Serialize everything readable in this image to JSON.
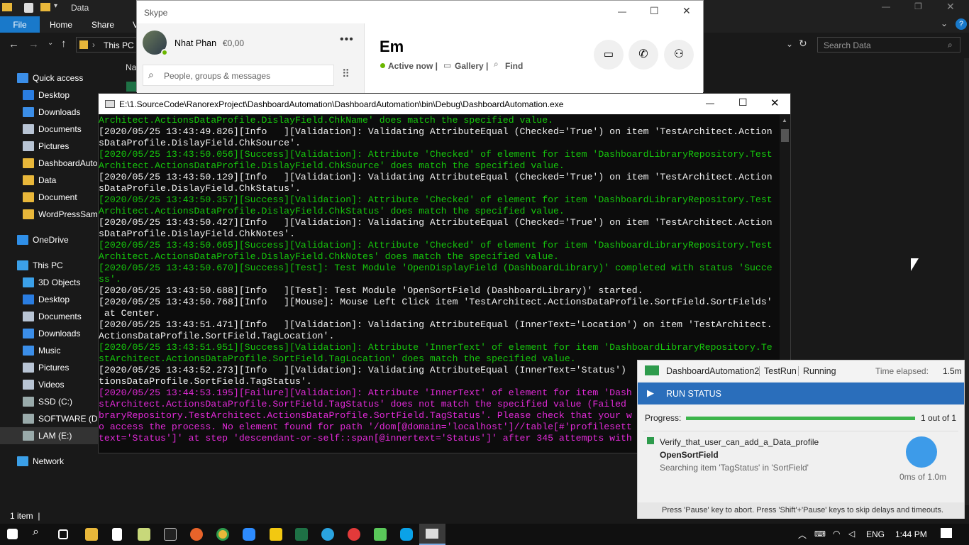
{
  "explorer": {
    "title": "Data",
    "ribbon_tabs": [
      "File",
      "Home",
      "Share",
      "V"
    ],
    "address_path": "This PC",
    "search_placeholder": "Search Data",
    "column_header": "Na",
    "nav_items": [
      {
        "label": "Quick access",
        "icon": "star-icon",
        "color": "#3b8ee8",
        "indent": 0
      },
      {
        "label": "Desktop",
        "icon": "desktop-icon",
        "color": "#2a7de1",
        "indent": 1
      },
      {
        "label": "Downloads",
        "icon": "download-icon",
        "color": "#3b8ee8",
        "indent": 1
      },
      {
        "label": "Documents",
        "icon": "documents-icon",
        "color": "#b8c4d4",
        "indent": 1
      },
      {
        "label": "Pictures",
        "icon": "pictures-icon",
        "color": "#b8c4d4",
        "indent": 1
      },
      {
        "label": "DashboardAuto",
        "icon": "folder-icon",
        "color": "#e8b73a",
        "indent": 1
      },
      {
        "label": "Data",
        "icon": "folder-icon",
        "color": "#e8b73a",
        "indent": 1
      },
      {
        "label": "Document",
        "icon": "folder-icon",
        "color": "#e8b73a",
        "indent": 1
      },
      {
        "label": "WordPressSamp",
        "icon": "folder-icon",
        "color": "#e8b73a",
        "indent": 1
      },
      {
        "label": "",
        "icon": "",
        "color": "",
        "indent": 0
      },
      {
        "label": "OneDrive",
        "icon": "cloud-icon",
        "color": "#2f8fe8",
        "indent": 0
      },
      {
        "label": "",
        "icon": "",
        "color": "",
        "indent": 0
      },
      {
        "label": "This PC",
        "icon": "computer-icon",
        "color": "#3ba0e8",
        "indent": 0
      },
      {
        "label": "3D Objects",
        "icon": "cube-icon",
        "color": "#3ba0e8",
        "indent": 1
      },
      {
        "label": "Desktop",
        "icon": "desktop-icon",
        "color": "#2a7de1",
        "indent": 1
      },
      {
        "label": "Documents",
        "icon": "documents-icon",
        "color": "#b8c4d4",
        "indent": 1
      },
      {
        "label": "Downloads",
        "icon": "download-icon",
        "color": "#3b8ee8",
        "indent": 1
      },
      {
        "label": "Music",
        "icon": "music-icon",
        "color": "#3b8ee8",
        "indent": 1
      },
      {
        "label": "Pictures",
        "icon": "pictures-icon",
        "color": "#b8c4d4",
        "indent": 1
      },
      {
        "label": "Videos",
        "icon": "video-icon",
        "color": "#b8c4d4",
        "indent": 1
      },
      {
        "label": "SSD (C:)",
        "icon": "drive-icon",
        "color": "#9aa",
        "indent": 1
      },
      {
        "label": "SOFTWARE (D:)",
        "icon": "drive-icon",
        "color": "#9aa",
        "indent": 1
      },
      {
        "label": "LAM (E:)",
        "icon": "drive-icon",
        "color": "#9aa",
        "indent": 1
      },
      {
        "label": "",
        "icon": "",
        "color": "",
        "indent": 0
      },
      {
        "label": "Network",
        "icon": "network-icon",
        "color": "#3ba0e8",
        "indent": 0
      }
    ],
    "status": "1 item  |"
  },
  "skype": {
    "title": "Skype",
    "user_name": "Nhat  Phan",
    "balance": "€0,00",
    "search_placeholder": "People, groups & messages",
    "contact_name": "Em",
    "presence": "Active now |",
    "gallery": "Gallery |",
    "find": "Find"
  },
  "console": {
    "title": "E:\\1.SourceCode\\RanorexProject\\DashboardAutomation\\DashboardAutomation\\bin\\Debug\\DashboardAutomation.exe",
    "lines": [
      {
        "t": "Architect.ActionsDataProfile.DislayField.ChkName' does match the specified value.",
        "c": "#16c60c"
      },
      {
        "t": "[2020/05/25 13:43:49.826][Info   ][Validation]: Validating AttributeEqual (Checked='True') on item 'TestArchitect.Action",
        "c": "#f2f2f2"
      },
      {
        "t": "sDataProfile.DislayField.ChkSource'.",
        "c": "#f2f2f2"
      },
      {
        "t": "[2020/05/25 13:43:50.056][Success][Validation]: Attribute 'Checked' of element for item 'DashboardLibraryRepository.Test",
        "c": "#16c60c"
      },
      {
        "t": "Architect.ActionsDataProfile.DislayField.ChkSource' does match the specified value.",
        "c": "#16c60c"
      },
      {
        "t": "[2020/05/25 13:43:50.129][Info   ][Validation]: Validating AttributeEqual (Checked='True') on item 'TestArchitect.Action",
        "c": "#f2f2f2"
      },
      {
        "t": "sDataProfile.DislayField.ChkStatus'.",
        "c": "#f2f2f2"
      },
      {
        "t": "[2020/05/25 13:43:50.357][Success][Validation]: Attribute 'Checked' of element for item 'DashboardLibraryRepository.Test",
        "c": "#16c60c"
      },
      {
        "t": "Architect.ActionsDataProfile.DislayField.ChkStatus' does match the specified value.",
        "c": "#16c60c"
      },
      {
        "t": "[2020/05/25 13:43:50.427][Info   ][Validation]: Validating AttributeEqual (Checked='True') on item 'TestArchitect.Action",
        "c": "#f2f2f2"
      },
      {
        "t": "sDataProfile.DislayField.ChkNotes'.",
        "c": "#f2f2f2"
      },
      {
        "t": "[2020/05/25 13:43:50.665][Success][Validation]: Attribute 'Checked' of element for item 'DashboardLibraryRepository.Test",
        "c": "#16c60c"
      },
      {
        "t": "Architect.ActionsDataProfile.DislayField.ChkNotes' does match the specified value.",
        "c": "#16c60c"
      },
      {
        "t": "[2020/05/25 13:43:50.670][Success][Test]: Test Module 'OpenDisplayField (DashboardLibrary)' completed with status 'Succe",
        "c": "#16c60c"
      },
      {
        "t": "ss'.",
        "c": "#16c60c"
      },
      {
        "t": "[2020/05/25 13:43:50.688][Info   ][Test]: Test Module 'OpenSortField (DashboardLibrary)' started.",
        "c": "#f2f2f2"
      },
      {
        "t": "[2020/05/25 13:43:50.768][Info   ][Mouse]: Mouse Left Click item 'TestArchitect.ActionsDataProfile.SortField.SortFields'",
        "c": "#f2f2f2"
      },
      {
        "t": " at Center.",
        "c": "#f2f2f2"
      },
      {
        "t": "[2020/05/25 13:43:51.471][Info   ][Validation]: Validating AttributeEqual (InnerText='Location') on item 'TestArchitect.",
        "c": "#f2f2f2"
      },
      {
        "t": "ActionsDataProfile.SortField.TagLocation'.",
        "c": "#f2f2f2"
      },
      {
        "t": "[2020/05/25 13:43:51.951][Success][Validation]: Attribute 'InnerText' of element for item 'DashboardLibraryRepository.Te",
        "c": "#16c60c"
      },
      {
        "t": "stArchitect.ActionsDataProfile.SortField.TagLocation' does match the specified value.",
        "c": "#16c60c"
      },
      {
        "t": "[2020/05/25 13:43:52.273][Info   ][Validation]: Validating AttributeEqual (InnerText='Status')",
        "c": "#f2f2f2"
      },
      {
        "t": "tionsDataProfile.SortField.TagStatus'.",
        "c": "#f2f2f2"
      },
      {
        "t": "[2020/05/25 13:44:53.195][Failure][Validation]: Attribute 'InnerText' of element for item 'Dash",
        "c": "#e22ad8"
      },
      {
        "t": "stArchitect.ActionsDataProfile.SortField.TagStatus' does not match the specified value (Failed",
        "c": "#e22ad8"
      },
      {
        "t": "braryRepository.TestArchitect.ActionsDataProfile.SortField.TagStatus'. Please check that your w",
        "c": "#e22ad8"
      },
      {
        "t": "o access the process. No element found for path '/dom[@domain='localhost']//table[#'profilesett",
        "c": "#e22ad8"
      },
      {
        "t": "text='Status']' at step 'descendant-or-self::span[@innertext='Status']' after 345 attempts with",
        "c": "#e22ad8"
      }
    ]
  },
  "ranorex": {
    "project": "DashboardAutomation2",
    "config": "TestRun",
    "state": "Running",
    "elapsed_label": "Time elapsed:",
    "elapsed_value": "1.5m",
    "run_status": "RUN STATUS",
    "progress_label": "Progress:",
    "progress_text": "1 out of 1",
    "progress_fraction": 1.0,
    "test_case": "Verify_that_user_can_add_a_Data_profile",
    "module": "OpenSortField",
    "action": "Searching item 'TagStatus' in 'SortField'",
    "timer": "0ms of 1.0m",
    "footer": "Press 'Pause' key to abort. Press 'Shift'+'Pause' keys to skip delays and timeouts."
  },
  "taskbar": {
    "language": "ENG",
    "time": "1:44 PM"
  },
  "colors": {
    "accent_blue": "#2a6ebb",
    "ranorex_green": "#2e9b4c",
    "progress_green": "#3cb44b"
  }
}
